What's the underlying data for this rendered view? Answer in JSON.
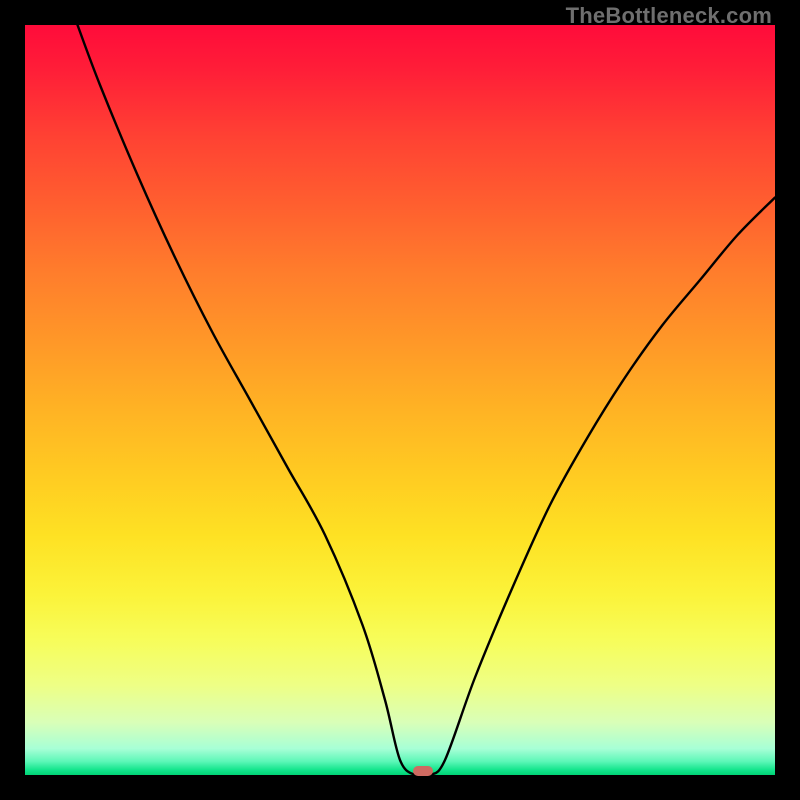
{
  "watermark": "TheBottleneck.com",
  "colors": {
    "curve_stroke": "#000000",
    "marker_fill": "#cf6a61",
    "frame_bg": "#000000"
  },
  "chart_data": {
    "type": "line",
    "title": "",
    "xlabel": "",
    "ylabel": "",
    "xlim": [
      0,
      100
    ],
    "ylim": [
      0,
      100
    ],
    "x": [
      7,
      10,
      15,
      20,
      25,
      30,
      35,
      40,
      45,
      48,
      50,
      52,
      54,
      56,
      60,
      65,
      70,
      75,
      80,
      85,
      90,
      95,
      100
    ],
    "values": [
      100,
      92,
      80,
      69,
      59,
      50,
      41,
      32,
      20,
      10,
      2,
      0,
      0,
      2,
      13,
      25,
      36,
      45,
      53,
      60,
      66,
      72,
      77
    ],
    "marker": {
      "x": 53,
      "y": 0.5
    },
    "notes": "V-shaped bottleneck curve; minimum near x≈53%."
  }
}
